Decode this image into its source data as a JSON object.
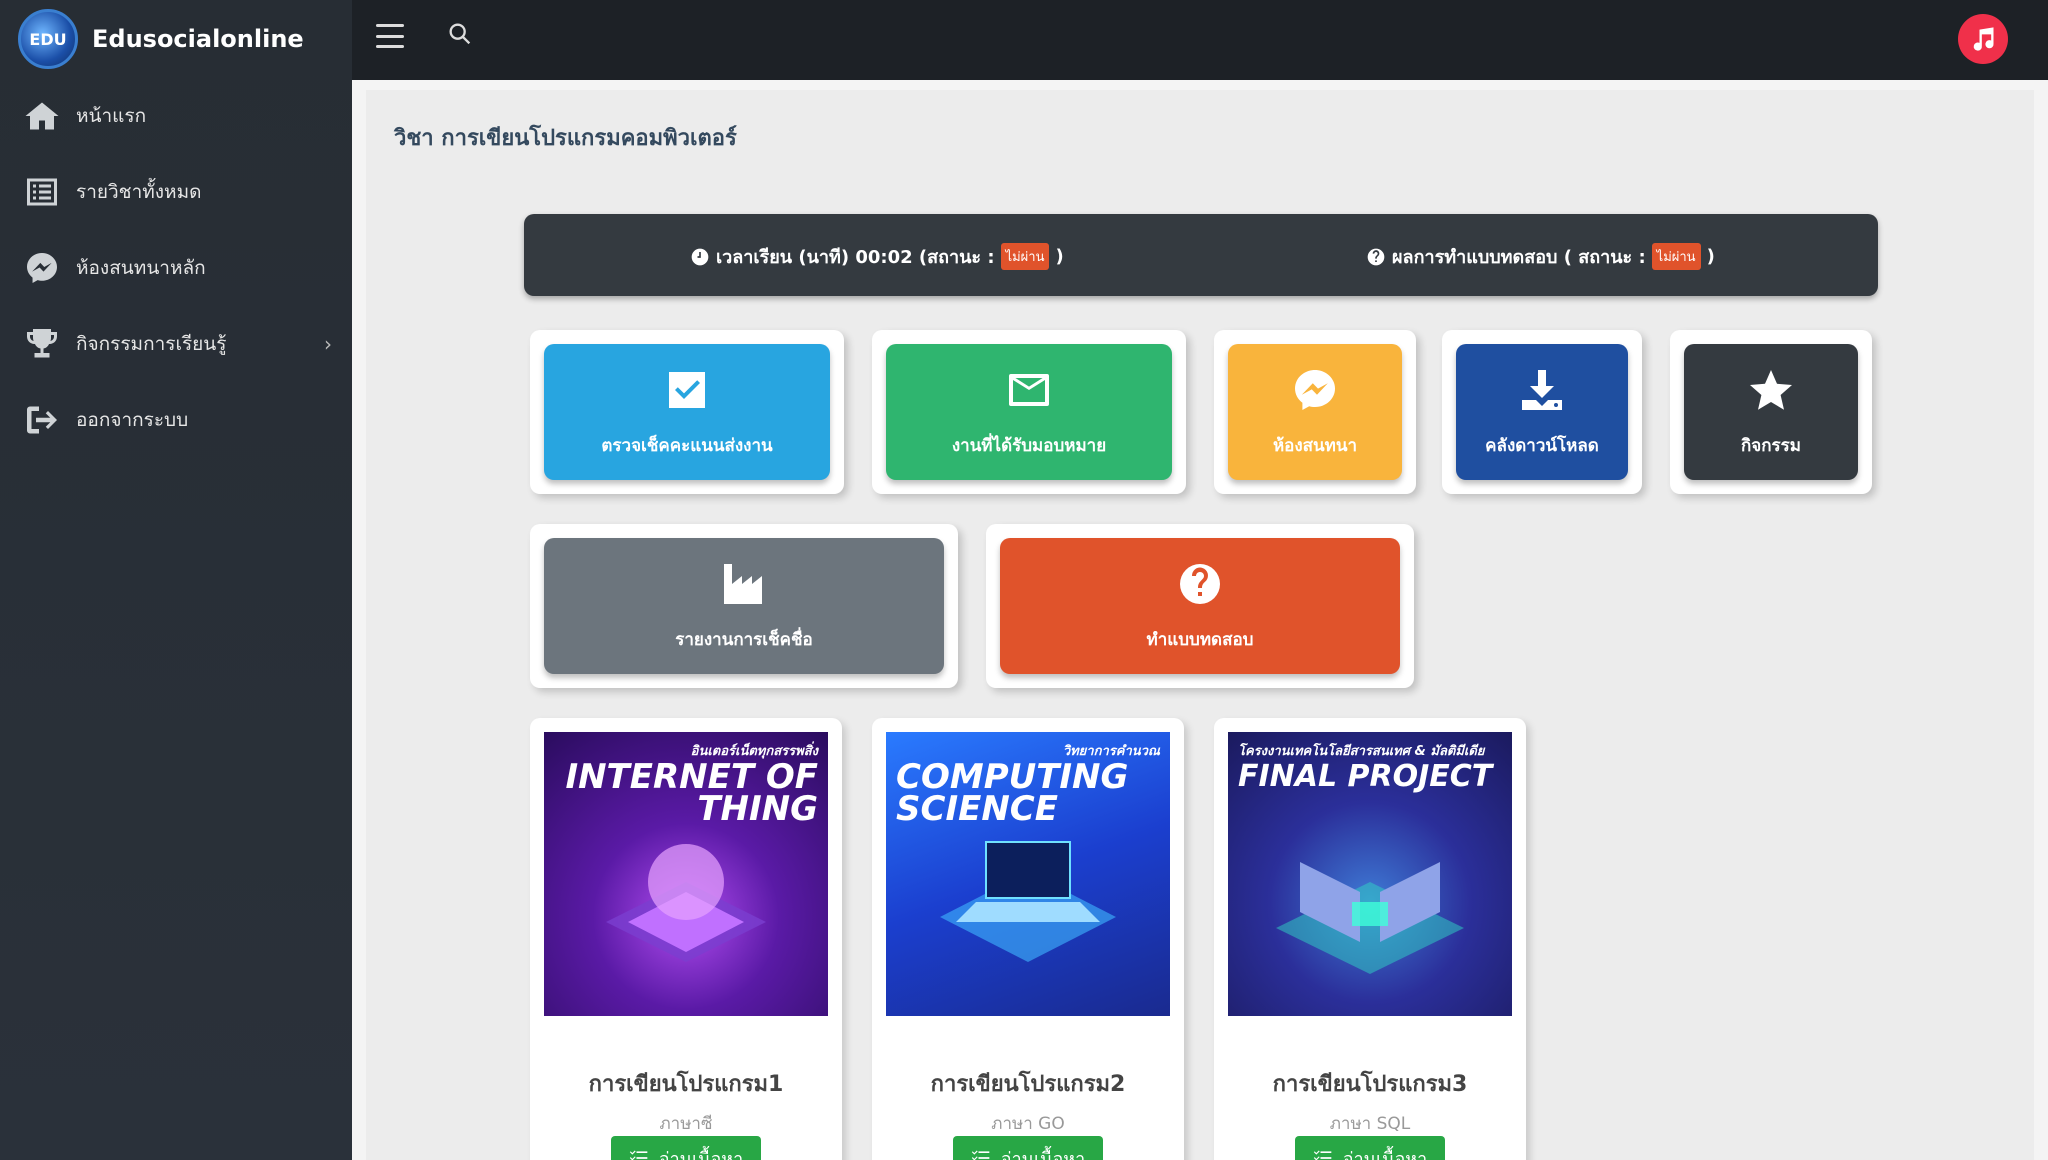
{
  "brand": {
    "name": "Edusocialonline",
    "logo_text": "EDU"
  },
  "sidebar": {
    "items": [
      {
        "label": "หน้าแรก",
        "icon": "home-icon"
      },
      {
        "label": "รายวิชาทั้งหมด",
        "icon": "list-icon"
      },
      {
        "label": "ห้องสนทนาหลัก",
        "icon": "messenger-icon"
      },
      {
        "label": "กิจกรรมการเรียนรู้",
        "icon": "trophy-icon"
      },
      {
        "label": "ออกจากระบบ",
        "icon": "sign-out-icon"
      }
    ]
  },
  "page": {
    "title": "วิชา การเขียนโปรแกรมคอมพิวเตอร์"
  },
  "status": {
    "time_label": "เวลาเรียน (นาที) 00:02 (สถานะ :",
    "time_badge": "ไม่ผ่าน",
    "time_close": ")",
    "quiz_label": "ผลการทำแบบทดสอบ ( สถานะ :",
    "quiz_badge": "ไม่ผ่าน",
    "quiz_close": ")"
  },
  "tiles": [
    {
      "label": "ตรวจเช็คคะแนนส่งงาน",
      "icon": "check-square-icon",
      "color": "#28a5e0"
    },
    {
      "label": "งานที่ได้รับมอบหมาย",
      "icon": "envelope-icon",
      "color": "#2fb56f"
    },
    {
      "label": "ห้องสนทนา",
      "icon": "messenger-icon",
      "color": "#f9b43c"
    },
    {
      "label": "คลังดาวน์โหลด",
      "icon": "download-icon",
      "color": "#1f4fa0"
    },
    {
      "label": "กิจกรรม",
      "icon": "star-icon",
      "color": "#343a40"
    },
    {
      "label": "รายงานการเช็คชื่อ",
      "icon": "industry-icon",
      "color": "#6c757d"
    },
    {
      "label": "ทำแบบทดสอบ",
      "icon": "question-circle-icon",
      "color": "#e0532b"
    }
  ],
  "courses": [
    {
      "cover_kicker": "อินเตอร์เน็ตทุกสรรพสิ่ง",
      "cover_title": "INTERNET OF THING",
      "title": "การเขียนโปรแกรม1",
      "subtitle": "ภาษาซี",
      "button": "อ่านเนื้อหา"
    },
    {
      "cover_kicker": "วิทยาการคำนวณ",
      "cover_title": "COMPUTING SCIENCE",
      "title": "การเขียนโปรแกรม2",
      "subtitle": "ภาษา GO",
      "button": "อ่านเนื้อหา"
    },
    {
      "cover_kicker": "โครงงานเทคโนโลยีสารสนเทศ & มัลติมีเดีย",
      "cover_title": "FINAL PROJECT",
      "title": "การเขียนโปรแกรม3",
      "subtitle": "ภาษา SQL",
      "button": "อ่านเนื้อหา"
    }
  ]
}
